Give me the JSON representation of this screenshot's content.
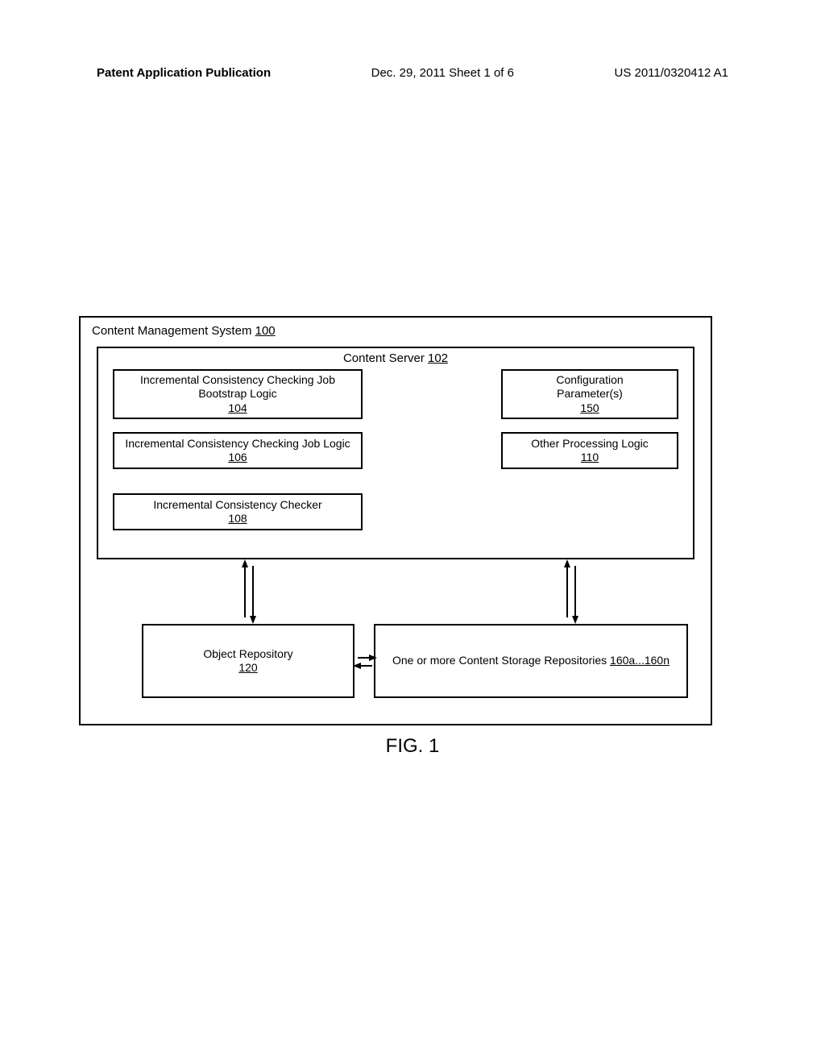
{
  "header": {
    "left": "Patent Application Publication",
    "center": "Dec. 29, 2011  Sheet 1 of 6",
    "right": "US 2011/0320412 A1"
  },
  "diagram": {
    "cms_label": "Content Management System ",
    "cms_ref": "100",
    "content_server_label": "Content Server ",
    "content_server_ref": "102",
    "box104": {
      "line1": "Incremental Consistency Checking Job",
      "line2": "Bootstrap Logic",
      "ref": "104"
    },
    "box106": {
      "line1": "Incremental Consistency Checking Job Logic",
      "ref": "106"
    },
    "box108": {
      "line1": "Incremental Consistency Checker",
      "ref": "108"
    },
    "box150": {
      "line1": "Configuration",
      "line2": "Parameter(s)",
      "ref": "150"
    },
    "box110": {
      "line1": "Other Processing Logic",
      "ref": "110"
    },
    "box120": {
      "line1": "Object Repository",
      "ref": "120"
    },
    "box160": {
      "line1": "One or more Content Storage Repositories ",
      "ref": "160a...160n"
    }
  },
  "figure_label": "FIG. 1"
}
